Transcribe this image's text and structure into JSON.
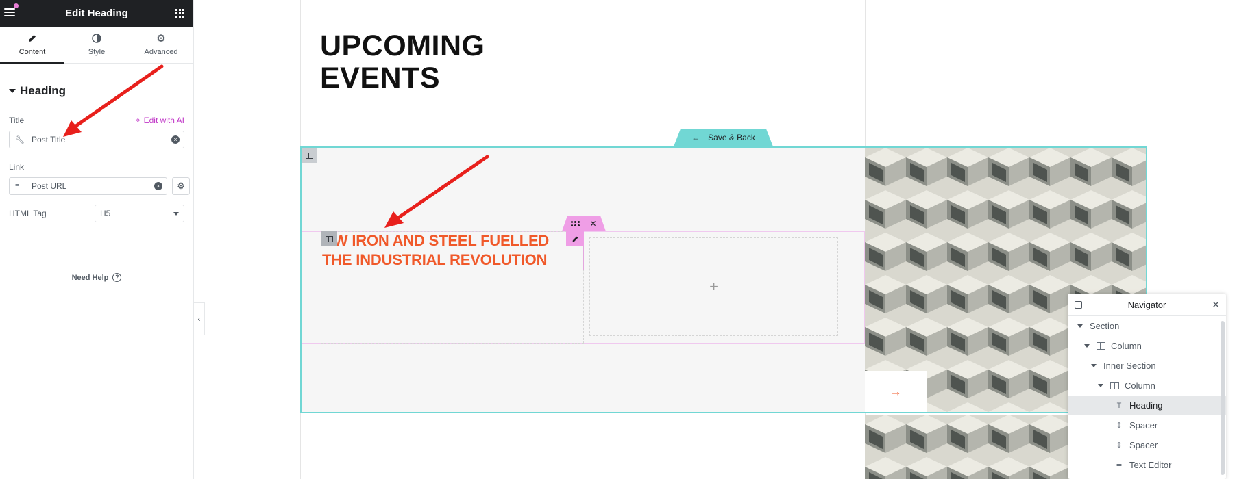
{
  "panel": {
    "title": "Edit Heading",
    "tabs": [
      {
        "label": "Content",
        "icon": "pencil-icon"
      },
      {
        "label": "Style",
        "icon": "half-circle-icon"
      },
      {
        "label": "Advanced",
        "icon": "gear-icon"
      }
    ],
    "section_title": "Heading",
    "title_label": "Title",
    "edit_ai": "Edit with AI",
    "title_value": "Post Title",
    "link_label": "Link",
    "link_value": "Post URL",
    "html_tag_label": "HTML Tag",
    "html_tag_value": "H5",
    "need_help": "Need Help"
  },
  "canvas": {
    "page_heading_line1": "UPCOMING",
    "page_heading_line2": "EVENTS",
    "save_back": "Save & Back",
    "heading_line1": "OW IRON AND STEEL FUELLED",
    "heading_line2": "THE INDUSTRIAL REVOLUTION",
    "add_symbol": "+",
    "colors": {
      "accent": "#71d7d4",
      "heading": "#f0592a",
      "widget_pink": "#ef9ee6"
    }
  },
  "navigator": {
    "title": "Navigator",
    "items": [
      {
        "label": "Section",
        "icon": "caret-icon"
      },
      {
        "label": "Column",
        "icon": "column-icon"
      },
      {
        "label": "Inner Section",
        "icon": "caret-icon"
      },
      {
        "label": "Column",
        "icon": "column-icon"
      },
      {
        "label": "Heading",
        "icon": "heading-icon"
      },
      {
        "label": "Spacer",
        "icon": "spacer-icon"
      },
      {
        "label": "Spacer",
        "icon": "spacer-icon"
      },
      {
        "label": "Text Editor",
        "icon": "text-editor-icon"
      }
    ]
  }
}
